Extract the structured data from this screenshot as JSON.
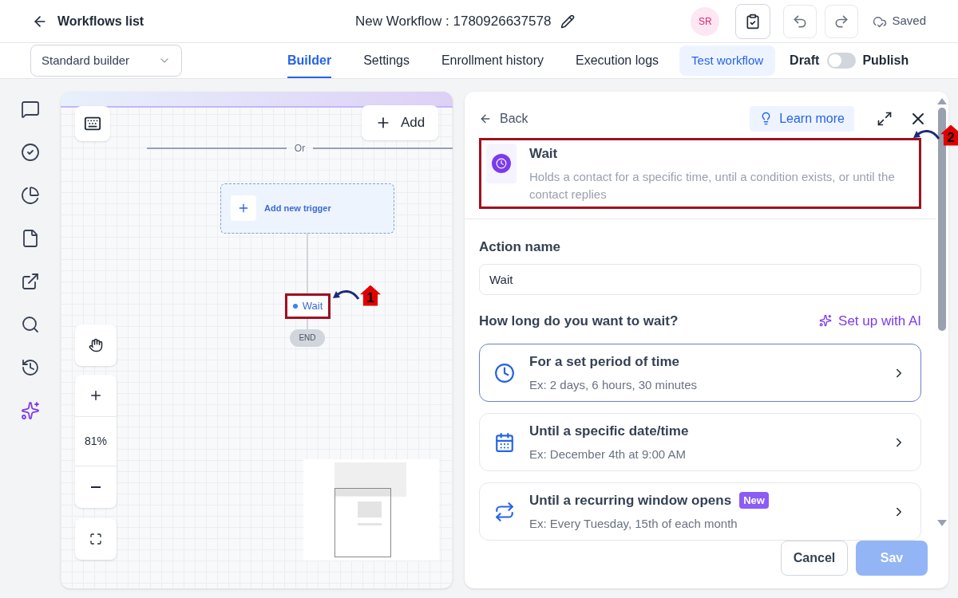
{
  "header": {
    "back_label": "Workflows list",
    "title": "New Workflow : 1780926637578",
    "avatar_initials": "SR",
    "status": "Saved"
  },
  "toolbar": {
    "builder_select": "Standard builder",
    "tabs": [
      {
        "label": "Builder",
        "selected": true
      },
      {
        "label": "Settings",
        "selected": false
      },
      {
        "label": "Enrollment history",
        "selected": false
      },
      {
        "label": "Execution logs",
        "selected": false
      }
    ],
    "test_button": "Test workflow",
    "draft_label": "Draft",
    "publish_on": false,
    "publish_label": "Publish"
  },
  "sidebar": {
    "items": [
      {
        "kind": "chat",
        "selected": false
      },
      {
        "kind": "check",
        "selected": false
      },
      {
        "kind": "pie",
        "selected": false
      },
      {
        "kind": "file",
        "selected": false
      },
      {
        "kind": "external",
        "selected": false
      },
      {
        "kind": "search",
        "selected": false
      },
      {
        "kind": "history",
        "selected": false
      },
      {
        "kind": "sparkles",
        "selected": true
      }
    ]
  },
  "canvas": {
    "add_button": "Add",
    "divider_label": "Or",
    "trigger": "Add new trigger",
    "node": "Wait",
    "end": "END",
    "zoom": "81%",
    "annotation": "1"
  },
  "panel": {
    "back": "Back",
    "learn_more": "Learn more",
    "action_title": "Wait",
    "action_description": "Holds a contact for a specific time, until a condition exists, or until the contact replies",
    "annotation": "2",
    "field_label": "Action name",
    "field_value": "Wait",
    "question": "How long do you want to wait?",
    "ai_link": "Set up with AI",
    "options": [
      {
        "kind": "clock",
        "title": "For a set period of time",
        "example": "Ex: 2 days, 6 hours, 30 minutes",
        "selected": true
      },
      {
        "kind": "calendar",
        "title": "Until a specific date/time",
        "example": "Ex: December 4th at 9:00 AM",
        "selected": false
      },
      {
        "kind": "repeat",
        "title": "Until a recurring window opens",
        "badge": "New",
        "example": "Ex: Every Tuesday, 15th of each month",
        "selected": false
      }
    ],
    "cancel": "Cancel",
    "save": "Sav"
  }
}
